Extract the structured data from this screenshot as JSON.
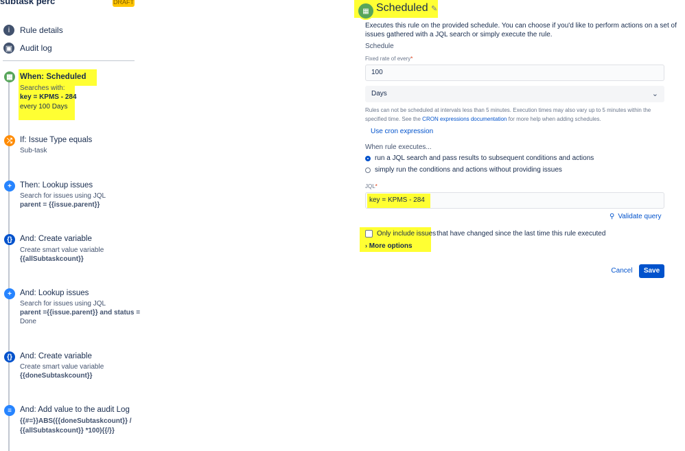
{
  "sidebar": {
    "rule_name": "subtask perc",
    "draft_badge": "DRAFT",
    "nav": [
      {
        "label": "Rule details",
        "icon": "info-icon"
      },
      {
        "label": "Audit log",
        "icon": "audit-log-icon"
      }
    ],
    "components": [
      {
        "title": "When: Scheduled",
        "lines": [
          "Searches with:",
          "key = KPMS - 284",
          "every 100 Days"
        ],
        "icon": "calendar-icon",
        "color": "#57a55a"
      },
      {
        "title": "If: Issue Type equals",
        "lines": [
          "Sub-task"
        ],
        "icon": "shuffle-icon",
        "color": "#ff8b00"
      },
      {
        "title": "Then: Lookup issues",
        "lines": [
          "Search for issues using JQL",
          "parent = {{issue.parent}}"
        ],
        "icon": "plus-icon",
        "color": "#2684ff"
      },
      {
        "title": "And: Create variable",
        "lines": [
          "Create smart value variable",
          "{{allSubtaskcount}}"
        ],
        "icon": "braces-icon",
        "color": "#0052cc"
      },
      {
        "title": "And: Lookup issues",
        "lines": [
          "Search for issues using JQL",
          "parent ={{issue.parent}} and status =",
          "Done"
        ],
        "icon": "plus-icon",
        "color": "#2684ff"
      },
      {
        "title": "And: Create variable",
        "lines": [
          "Create smart value variable",
          "{{doneSubtaskcount}}"
        ],
        "icon": "braces-icon",
        "color": "#0052cc"
      },
      {
        "title": "And: Add value to the audit Log",
        "lines": [
          "{{#=}}ABS({{doneSubtaskcount}} /",
          "{{allSubtaskcount}} *100){{/}}"
        ],
        "icon": "log-icon",
        "color": "#2684ff"
      }
    ]
  },
  "panel": {
    "title": "Scheduled",
    "description_1": "Executes this rule on the provided schedule. You can choose if you'd like to perform actions on a set of",
    "description_2": "issues gathered with a JQL search or simply execute the rule.",
    "schedule_label": "Schedule",
    "fixed_rate_label": "Fixed rate of every",
    "required_mark": "*",
    "fixed_rate_value": "100",
    "unit_value": "Days",
    "help_1": "Rules can not be scheduled at intervals less than 5 minutes. Execution times may also vary up to 5 minutes within the",
    "help_2_pre": "specified time. See the",
    "help_2_link": "CRON expressions documentation",
    "help_2_post": "for more help when adding schedules.",
    "cron_link": "Use cron expression",
    "when_executes_label": "When rule executes...",
    "radio_1": "run a JQL search and pass results to subsequent conditions and actions",
    "radio_2": "simply run the conditions and actions without providing issues",
    "jql_label": "JQL",
    "jql_value": "key = KPMS - 284",
    "validate_label": "Validate query",
    "checkbox_hl": "Only include issues",
    "checkbox_rest": "that have changed since the last time this rule executed",
    "more_options": "More options",
    "cancel_label": "Cancel",
    "save_label": "Save"
  },
  "colors": {
    "highlight": "#ffff33",
    "primary": "#0052cc",
    "trigger": "#57a55a"
  }
}
